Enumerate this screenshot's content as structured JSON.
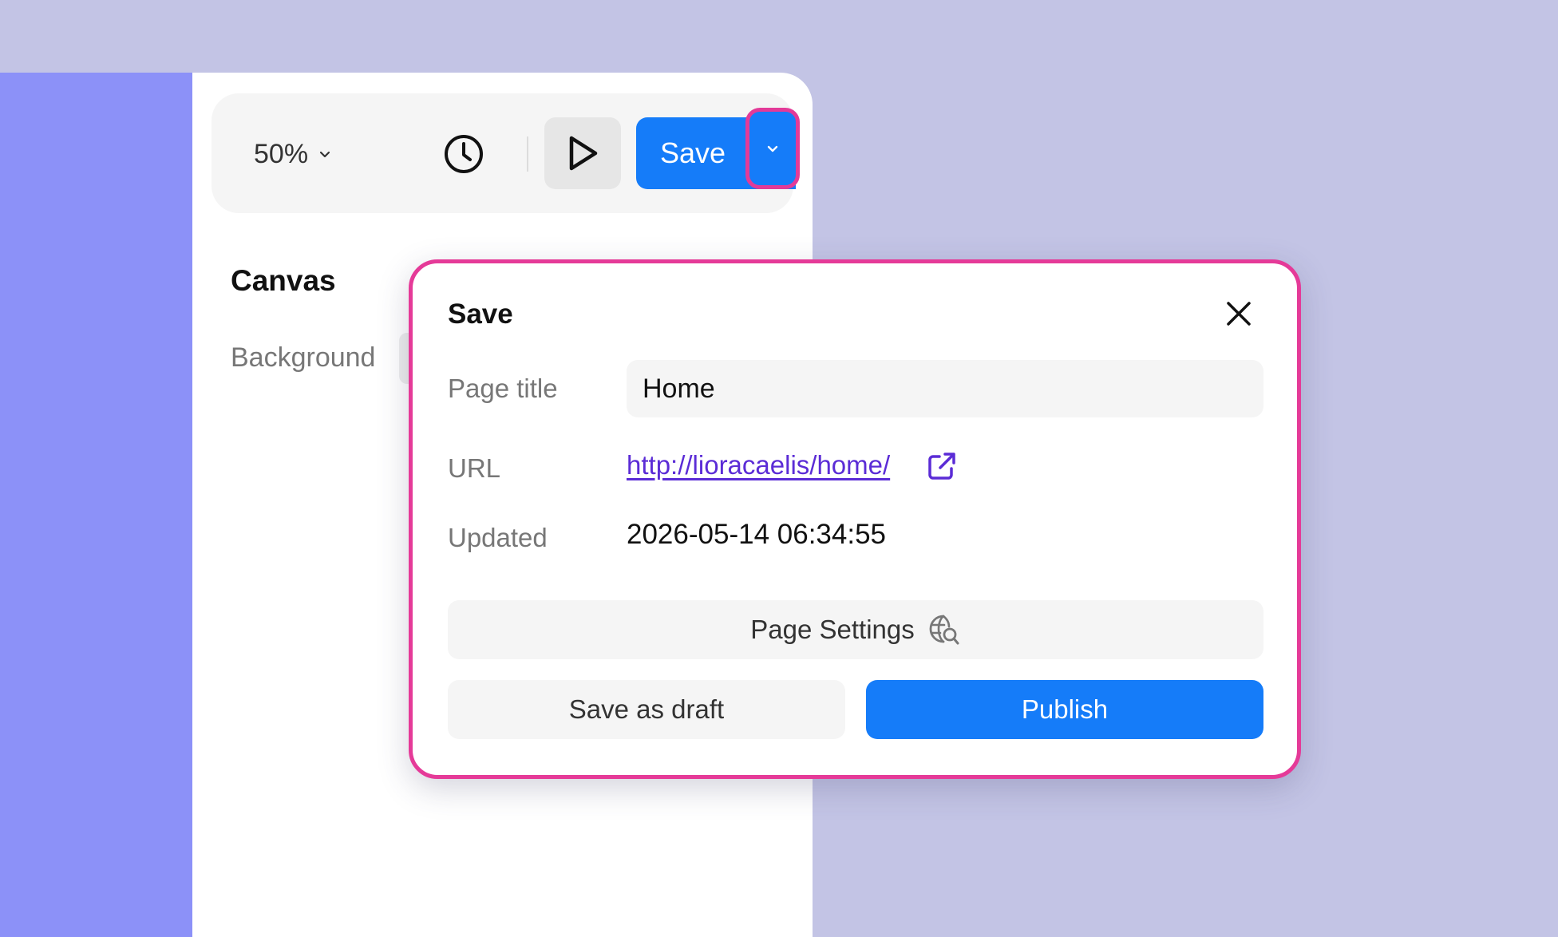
{
  "toolbar": {
    "zoom_level": "50%",
    "save_label": "Save",
    "icons": {
      "zoom": "chevron-down-icon",
      "history": "clock-icon",
      "preview": "play-icon",
      "save_menu": "chevron-down-icon"
    }
  },
  "sidebar": {
    "section_title": "Canvas",
    "background_label": "Background"
  },
  "save_dialog": {
    "title": "Save",
    "fields": {
      "page_title_label": "Page title",
      "page_title_value": "Home",
      "url_label": "URL",
      "url_value": "http://lioracaelis/home/",
      "updated_label": "Updated",
      "updated_value": "2026-05-14 06:34:55"
    },
    "page_settings_label": "Page Settings",
    "save_draft_label": "Save as draft",
    "publish_label": "Publish"
  },
  "colors": {
    "accent": "#157cf9",
    "highlight": "#e53a98",
    "link": "#5b2cd6",
    "backdrop": "#c3c4e5",
    "sidebar": "#8c91f8"
  }
}
